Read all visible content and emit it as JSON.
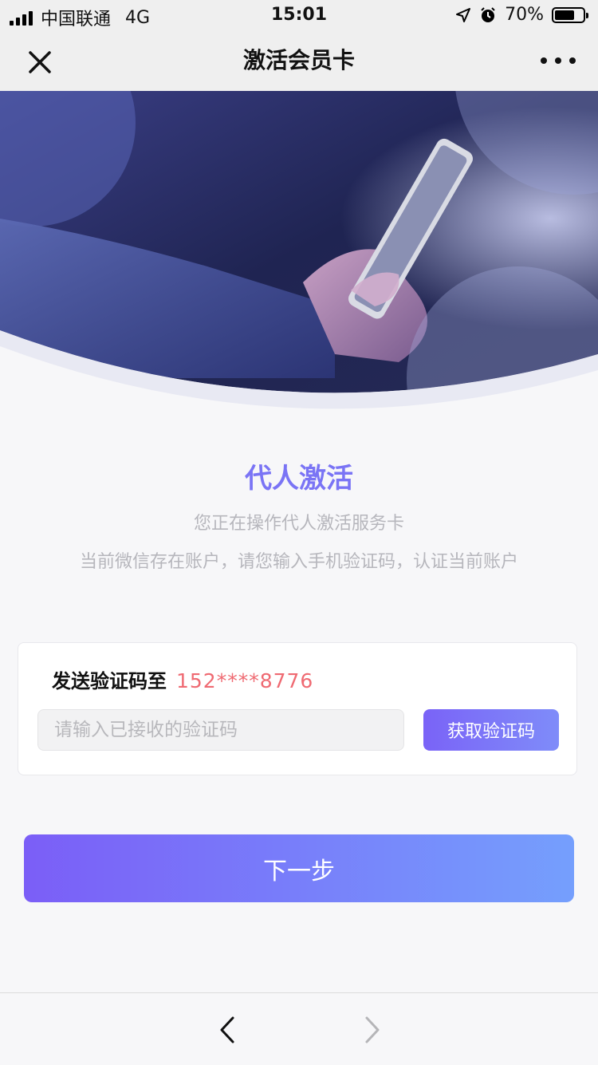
{
  "status_bar": {
    "carrier": "中国联通",
    "network": "4G",
    "time": "15:01",
    "battery_percent_label": "70%",
    "battery_level": 0.7
  },
  "nav": {
    "title": "激活会员卡",
    "close_icon": "close-icon",
    "more_icon": "more-icon"
  },
  "hero": {
    "image": "hand-holding-phone-photo"
  },
  "intro": {
    "headline": "代人激活",
    "line1": "您正在操作代人激活服务卡",
    "line2": "当前微信存在账户，请您输入手机验证码，认证当前账户"
  },
  "verify": {
    "send_label": "发送验证码至",
    "phone_masked": "152****8776",
    "code_value": "",
    "code_placeholder": "请输入已接收的验证码",
    "get_code_label": "获取验证码"
  },
  "next_button": {
    "label": "下一步"
  },
  "bottom_bar": {
    "back_icon": "chevron-left-icon",
    "forward_icon": "chevron-right-icon"
  },
  "colors": {
    "accent": "#7a74f5",
    "phone": "#ef6a72",
    "gradient_start": "#7b5ef7",
    "gradient_end": "#759ffd",
    "muted_text": "#b6b6bc"
  }
}
